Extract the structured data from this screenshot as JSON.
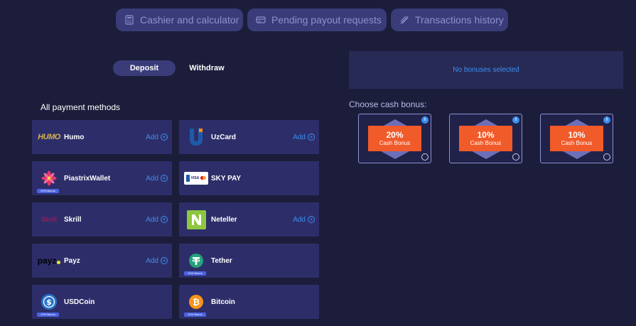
{
  "top_tabs": [
    {
      "label": "Cashier and calculator",
      "icon": "calculator-icon"
    },
    {
      "label": "Pending payout requests",
      "icon": "payout-icon"
    },
    {
      "label": "Transactions history",
      "icon": "history-icon"
    }
  ],
  "mode": {
    "deposit": "Deposit",
    "withdraw": "Withdraw",
    "active": "deposit"
  },
  "methods_title": "All payment methods",
  "methods": [
    {
      "name": "Humo",
      "add": "Add",
      "bonus": ""
    },
    {
      "name": "UzCard",
      "add": "Add",
      "bonus": ""
    },
    {
      "name": "PiastrixWallet",
      "add": "Add",
      "bonus": "20% Bonus"
    },
    {
      "name": "SKY PAY",
      "add": "",
      "bonus": ""
    },
    {
      "name": "Skrill",
      "add": "Add",
      "bonus": ""
    },
    {
      "name": "Neteller",
      "add": "Add",
      "bonus": ""
    },
    {
      "name": "Payz",
      "add": "Add",
      "bonus": ""
    },
    {
      "name": "Tether",
      "add": "",
      "bonus": "11% Bonus"
    },
    {
      "name": "USDCoin",
      "add": "",
      "bonus": "10% Bonus"
    },
    {
      "name": "Bitcoin",
      "add": "",
      "bonus": "11% Bonus"
    }
  ],
  "logo_text": {
    "humo": "HUMO",
    "skrill": "Skrill",
    "payz": "payz",
    "skypay": "VISA"
  },
  "no_bonus_text": "No bonuses selected",
  "choose_bonus_title": "Choose cash bonus:",
  "bonuses": [
    {
      "percent": "20%",
      "label": "Cash Bonus"
    },
    {
      "percent": "10%",
      "label": "Cash Bonus"
    },
    {
      "percent": "10%",
      "label": "Cash Bonus"
    }
  ],
  "info_glyph": "i",
  "plus_glyph": "+",
  "colors": {
    "accent": "#3d8ef0",
    "bonus_orange": "#f15a29",
    "card": "#2d2e69",
    "bg": "#1b1d3a"
  }
}
